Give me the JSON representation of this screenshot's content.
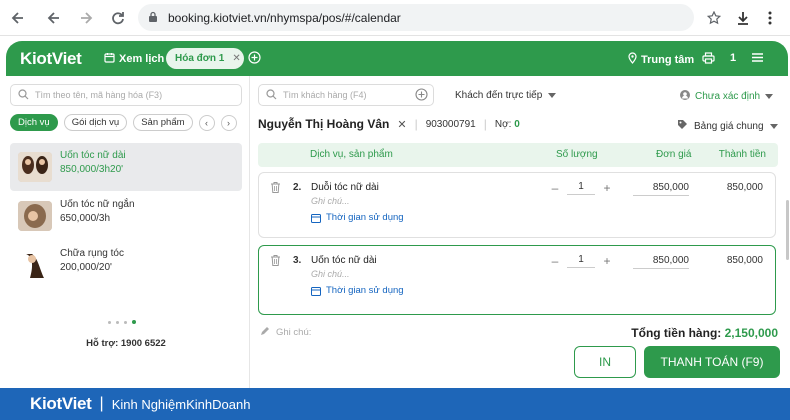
{
  "browser": {
    "url": "booking.kiotviet.vn/nhymspa/pos/#/calendar"
  },
  "header": {
    "logo": "KiotViet",
    "calendar_label": "Xem lịch",
    "tab_label": "Hóa đơn 1",
    "location": "Trung tâm",
    "print_count": "1"
  },
  "left": {
    "search_placeholder": "Tìm theo tên, mã hàng hóa (F3)",
    "filters": [
      "Dịch vụ",
      "Gói dịch vụ",
      "Sản phẩm"
    ],
    "services": [
      {
        "name": "Uốn tóc nữ dài",
        "price": "850,000/3h20'"
      },
      {
        "name": "Uốn tóc nữ ngắn",
        "price": "650,000/3h"
      },
      {
        "name": "Chữa rụng tóc",
        "price": "200,000/20'"
      }
    ],
    "support": "Hỗ trợ: 1900 6522"
  },
  "right": {
    "customer_search_placeholder": "Tìm khách hàng (F4)",
    "customer_type": "Khách đến trực tiếp",
    "staff": "Chưa xác định",
    "customer_name": "Nguyễn Thị Hoàng Vân",
    "customer_phone": "903000791",
    "debt_label": "Nợ:",
    "debt_value": "0",
    "price_list": "Bảng giá chung",
    "columns": {
      "service": "Dịch vụ, sản phẩm",
      "qty": "Số lượng",
      "unit": "Đơn giá",
      "total": "Thành tiền"
    },
    "lines": [
      {
        "num": "2.",
        "name": "Duỗi tóc nữ dài",
        "note": "Ghi chú...",
        "time": "Thời gian sử dụng",
        "qty": "1",
        "unit_price": "850,000",
        "line_total": "850,000"
      },
      {
        "num": "3.",
        "name": "Uốn tóc nữ dài",
        "note": "Ghi chú...",
        "time": "Thời gian sử dụng",
        "qty": "1",
        "unit_price": "850,000",
        "line_total": "850,000"
      }
    ],
    "memo": "Ghi chú:",
    "total_label": "Tổng tiền hàng:",
    "total_value": "2,150,000",
    "print_button": "IN",
    "pay_button": "THANH TOÁN (F9)"
  },
  "footer": {
    "brand": "KiotViet",
    "tagline": "Kinh NghiệmKinhDoanh"
  },
  "colors": {
    "primary": "#2e9a4c",
    "link": "#1565c0",
    "footer": "#1e66b8"
  }
}
